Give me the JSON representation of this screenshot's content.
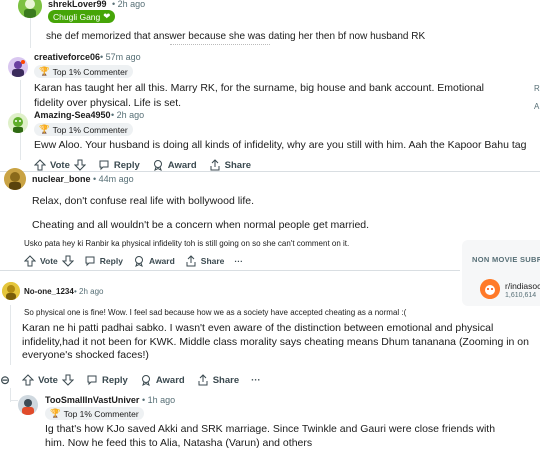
{
  "colors": {
    "accent": "#46a508",
    "text": "#1c1c1c",
    "meta": "#576f76",
    "orange": "#ff4500"
  },
  "comments": [
    {
      "user": "shrekLover99",
      "time": "• 2h ago",
      "flair": "Chugli Gang",
      "flair_icon": "heart-icon",
      "text": "she def memorized that answer because she was dating her then bf now husband RK"
    },
    {
      "user": "creativeforce06",
      "time": "• 57m ago",
      "flair": "Top 1% Commenter",
      "flair_icon": "trophy-icon",
      "text": "Karan has taught her all this. Marry RK, for the surname, big house and bank account. Emotional fidelity over physical. Life is set."
    },
    {
      "user": "Amazing-Sea4950",
      "time": "• 2h ago",
      "flair": "Top 1% Commenter",
      "flair_icon": "trophy-icon",
      "text": "Eww Aloo. Your husband is doing all kinds of infidelity, why are you still with him. Aah the Kapoor Bahu tag",
      "actions": {
        "vote": "Vote",
        "reply": "Reply",
        "award": "Award",
        "share": "Share"
      }
    },
    {
      "user": "nuclear_bone",
      "time": "• 44m ago",
      "text1": "Relax, don't confuse real life with bollywood life.",
      "text2": "Cheating and all wouldn't be a concern when normal people get married.",
      "text3": "Usko pata hey ki Ranbir ka physical infidelity toh is still going on so she can't comment on it.",
      "actions": {
        "vote": "Vote",
        "reply": "Reply",
        "award": "Award",
        "share": "Share",
        "more": "···"
      }
    },
    {
      "user": "No-one_1234",
      "time": "• 2h ago",
      "text1": "So physical one is fine! Wow. I feel sad because how we as a society have accepted cheating as a normal :(",
      "text2": "Karan ne hi patti padhai sabko. I wasn't even aware of the distinction between emotional and physical infidelity,had it not been for KWK. Middle class morality says cheating means Dhum tananana (Zooming in on everyone's shocked faces!)",
      "actions": {
        "collapse": "⊖",
        "vote": "Vote",
        "reply": "Reply",
        "award": "Award",
        "share": "Share",
        "more": "···"
      }
    },
    {
      "user": "TooSmallInVastUniver",
      "time": "• 1h ago",
      "flair": "Top 1% Commenter",
      "flair_icon": "trophy-icon",
      "text": "Ig that's how KJo saved Akki and SRK marriage. Since Twinkle and Gauri were close friends with him. Now he feed this to Alia, Natasha (Varun) and others"
    }
  ],
  "sidebar": {
    "heading": "NON MOVIE SUBRE",
    "community": "r/indiasoc",
    "members": "1,610,614",
    "right_fragments": [
      "R",
      "A"
    ]
  }
}
